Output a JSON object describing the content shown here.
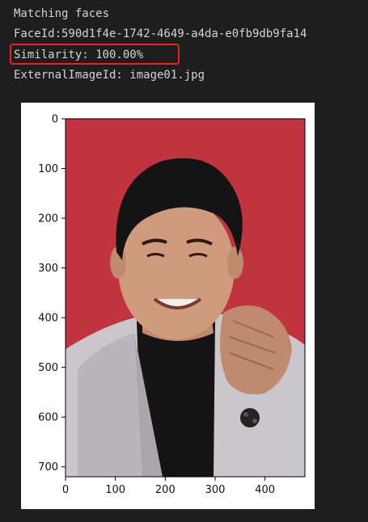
{
  "output_lines": {
    "title": "Matching faces",
    "face_id": "FaceId:590d1f4e-1742-4649-a4da-e0fb9db9fa14",
    "similarity": "Similarity: 100.00%",
    "external_image_id": "ExternalImageId: image01.jpg"
  },
  "colors": {
    "background": "#1e1e1e",
    "text": "#d4d4d4",
    "highlight": "#e8231f",
    "photo_background": "#c1333f"
  },
  "plot": {
    "image_width": 480,
    "image_height": 720,
    "xlim": [
      0,
      480
    ],
    "ylim": [
      720,
      0
    ],
    "x_ticks": [
      "0",
      "100",
      "200",
      "300",
      "400"
    ],
    "y_ticks": [
      "0",
      "100",
      "200",
      "300",
      "400",
      "500",
      "600",
      "700"
    ]
  }
}
